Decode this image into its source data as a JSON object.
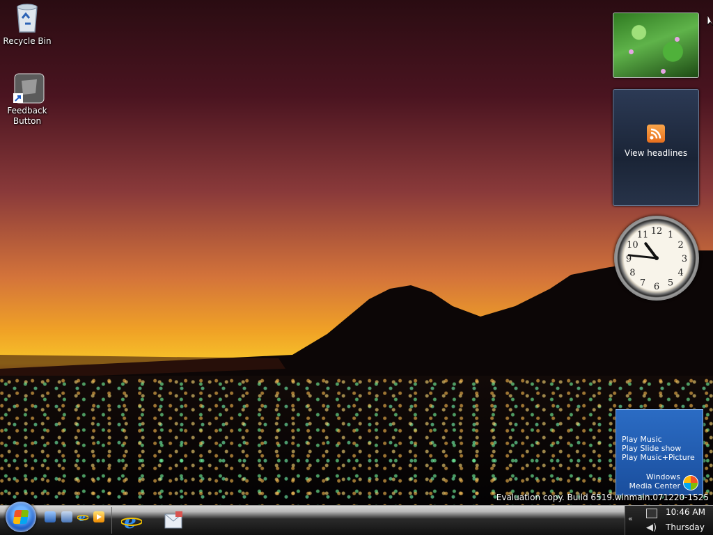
{
  "desktop": {
    "icons": [
      {
        "label": "Recycle Bin",
        "icon": "recycle-bin-icon"
      },
      {
        "label": "Feedback Button",
        "icon": "feedback-shortcut-icon"
      }
    ],
    "watermark": "Evaluation copy. Build 6519.winmain.071220-1525"
  },
  "gadgets": {
    "photo": {
      "icon": "slideshow-photo"
    },
    "feeds": {
      "label": "View headlines",
      "icon": "rss-icon"
    },
    "clock": {
      "hour": 10,
      "minute": 46,
      "numerals": [
        "12",
        "1",
        "2",
        "3",
        "4",
        "5",
        "6",
        "7",
        "8",
        "9",
        "10",
        "11"
      ]
    },
    "media_center": {
      "items": [
        "Play Music",
        "Play Slide show",
        "Play Music+Picture"
      ],
      "brand_line1": "Windows",
      "brand_line2": "Media Center"
    }
  },
  "taskbar": {
    "start_icon": "windows-start-orb",
    "quick_launch": [
      "show-desktop-icon",
      "switch-windows-icon",
      "internet-explorer-icon",
      "media-player-icon"
    ],
    "apps": [
      "internet-explorer-icon",
      "windows-mail-icon"
    ],
    "tray": {
      "time": "10:46 AM",
      "day": "Thursday",
      "chevron": "«",
      "volume_glyph": "◀)"
    }
  },
  "colors": {
    "sky_top": "#2a0c12",
    "sunset": "#f0a226",
    "taskbar": "#111111",
    "wmc_blue": "#1a4e9d"
  }
}
